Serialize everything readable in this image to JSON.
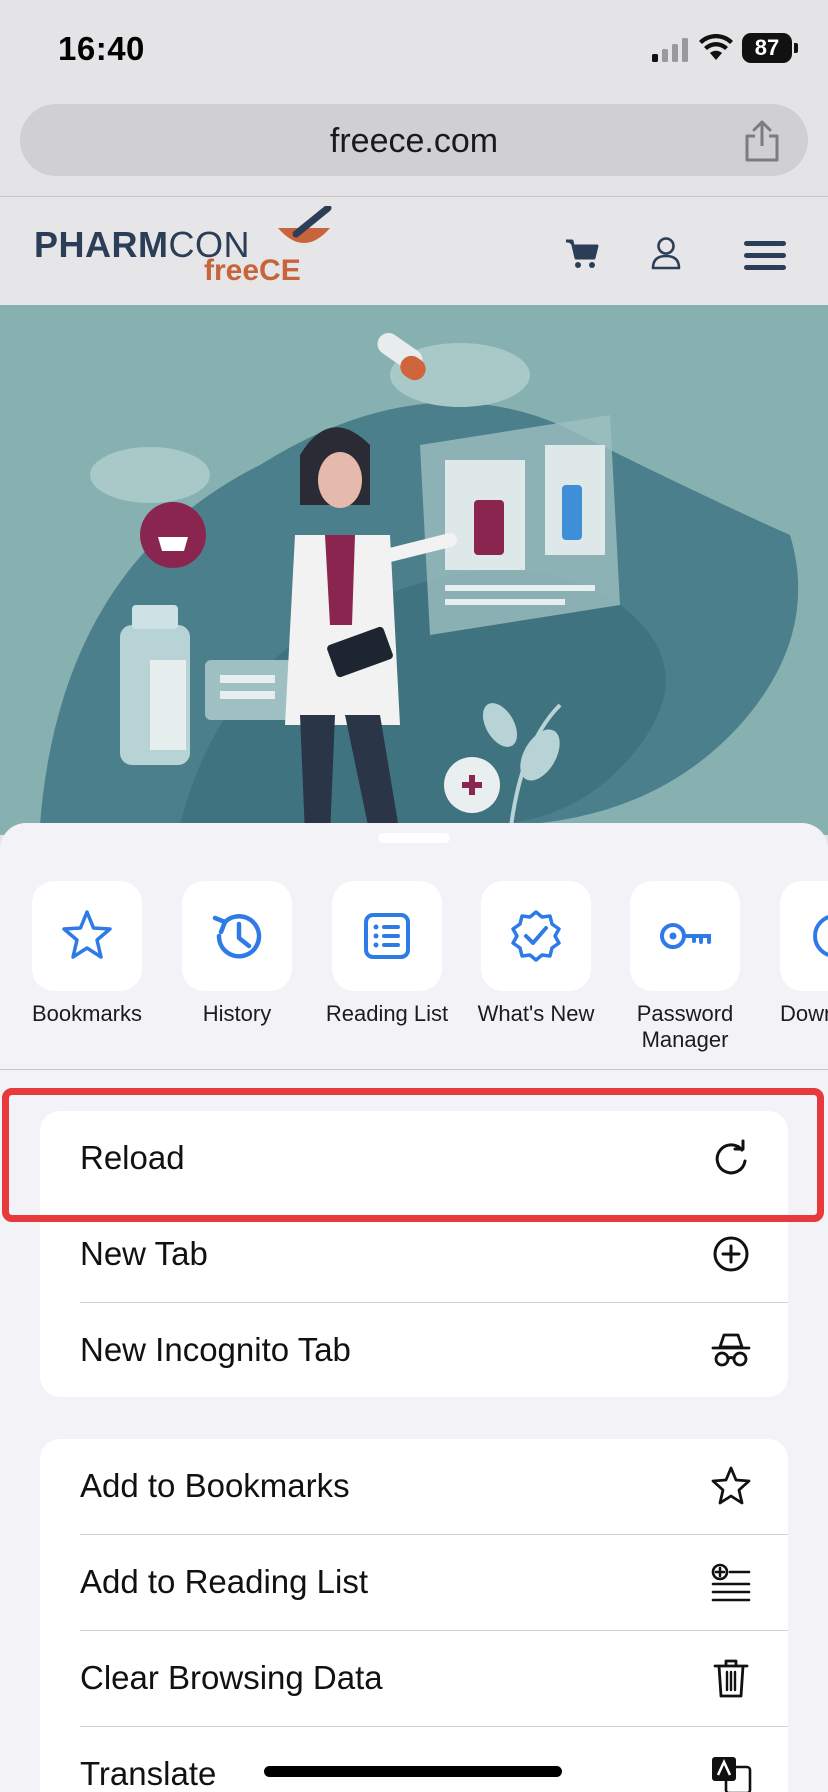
{
  "status_bar": {
    "time": "16:40",
    "battery": "87"
  },
  "browser": {
    "url": "freece.com"
  },
  "site": {
    "logo_main": "PHARM",
    "logo_main2": "CON",
    "logo_sub": "freeCE"
  },
  "colors": {
    "accent": "#2f7be6",
    "highlight": "#e83a3c",
    "brand_navy": "#2c3e57",
    "brand_orange": "#c8643c"
  },
  "quick_actions": [
    {
      "label": "Bookmarks",
      "icon": "star-icon"
    },
    {
      "label": "History",
      "icon": "history-icon"
    },
    {
      "label": "Reading List",
      "icon": "reading-list-icon"
    },
    {
      "label": "What's New",
      "icon": "whats-new-icon"
    },
    {
      "label": "Password Manager",
      "icon": "key-icon"
    },
    {
      "label": "Down",
      "icon": "download-icon"
    }
  ],
  "menu_group_1": [
    {
      "label": "Reload",
      "icon": "reload-icon"
    },
    {
      "label": "New Tab",
      "icon": "plus-circle-icon"
    },
    {
      "label": "New Incognito Tab",
      "icon": "incognito-icon"
    }
  ],
  "menu_group_2": [
    {
      "label": "Add to Bookmarks",
      "icon": "star-outline-icon"
    },
    {
      "label": "Add to Reading List",
      "icon": "add-reading-list-icon"
    },
    {
      "label": "Clear Browsing Data",
      "icon": "trash-icon"
    },
    {
      "label": "Translate",
      "icon": "translate-icon"
    }
  ]
}
